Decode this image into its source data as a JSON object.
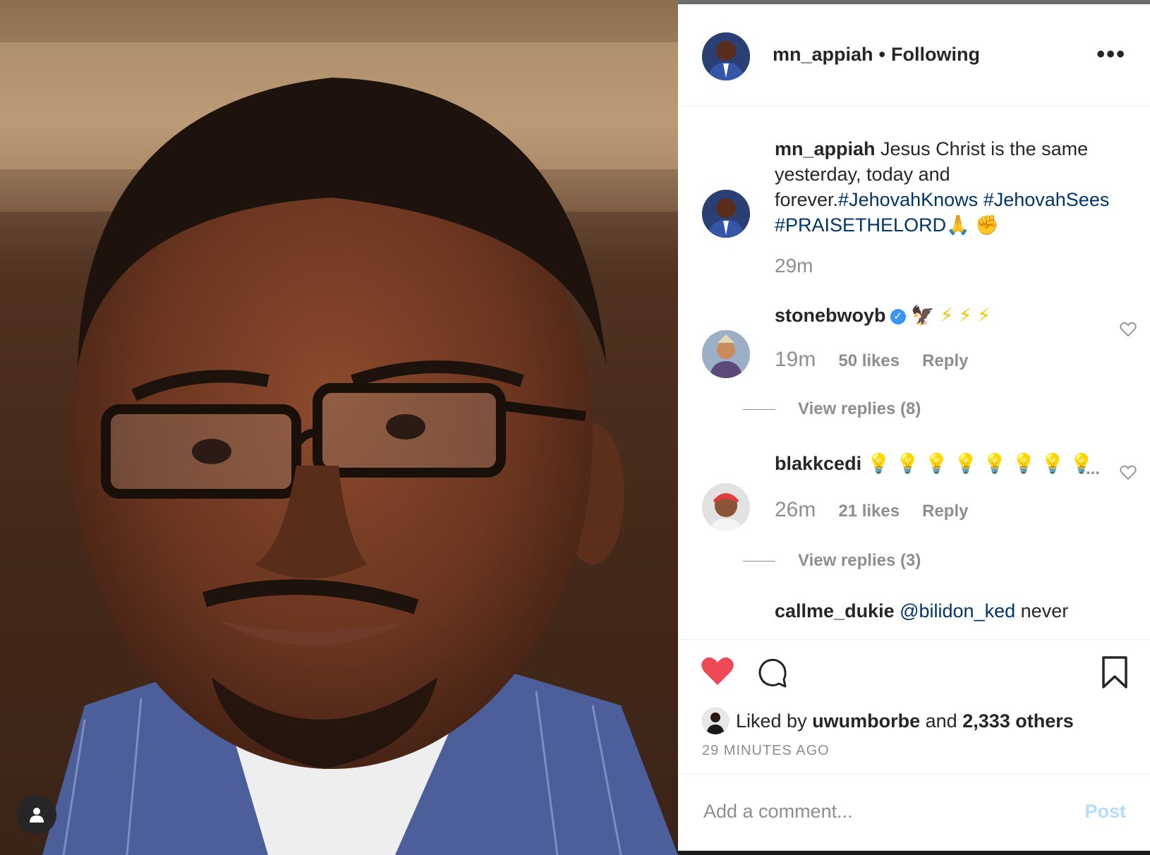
{
  "post": {
    "username": "mn_appiah",
    "separator": "•",
    "follow_status": "Following",
    "more_label": "•••"
  },
  "caption": {
    "username": "mn_appiah",
    "text": "Jesus Christ is the same yesterday, today and forever.",
    "hashtags": [
      "#JehovahKnows",
      "#JehovahSees",
      "#PRAISETHELORD"
    ],
    "emojis": "🙏 ✊",
    "time": "29m"
  },
  "comments": [
    {
      "username": "stonebwoyb",
      "verified": true,
      "text": "🦅 ⚡ ⚡ ⚡",
      "time": "19m",
      "likes": "50 likes",
      "reply_label": "Reply",
      "view_replies": "View replies (8)"
    },
    {
      "username": "blakkcedi",
      "verified": false,
      "text": "💡 💡 💡 💡 💡 💡 💡 💡",
      "more": "...",
      "time": "26m",
      "likes": "21 likes",
      "reply_label": "Reply",
      "view_replies": "View replies (3)"
    }
  ],
  "partial_comment": {
    "username": "callme_dukie",
    "text": "@bilidon_ked never"
  },
  "likes": {
    "prefix": "Liked by",
    "user": "uwumborbe",
    "and": "and",
    "others": "2,333 others"
  },
  "timestamp": "29 MINUTES AGO",
  "comment_box": {
    "placeholder": "Add a comment...",
    "post_label": "Post"
  },
  "colors": {
    "like_red": "#ed4956",
    "hashtag_blue": "#003569",
    "muted_gray": "#8e8e8e",
    "post_disabled": "#b2dffc",
    "verified_blue": "#3897f0"
  }
}
